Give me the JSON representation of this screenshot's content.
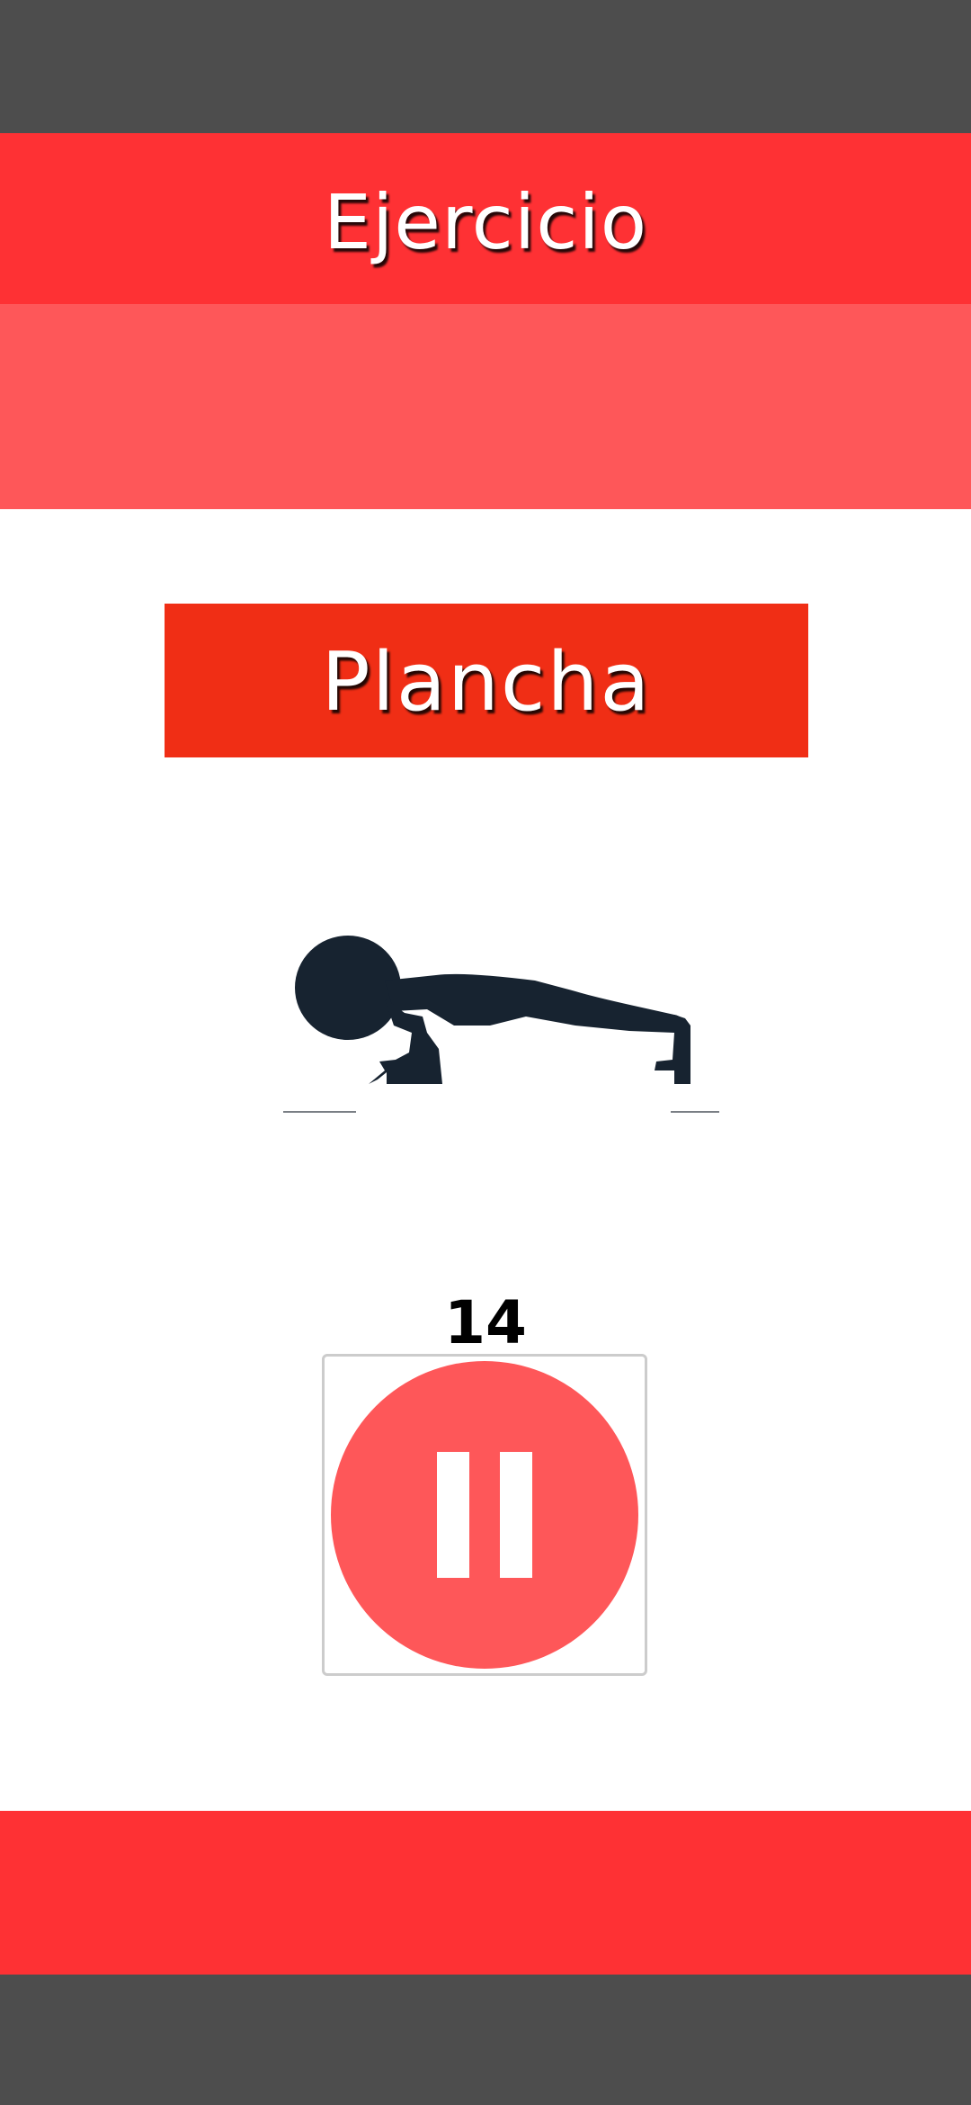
{
  "header": {
    "title": "Ejercicio"
  },
  "exercise": {
    "name": "Plancha",
    "illustration": "push-up-figure"
  },
  "timer": {
    "count": "14"
  },
  "controls": {
    "pause_icon": "pause-icon"
  },
  "colors": {
    "primary_red": "#fe3134",
    "light_red": "#fe5759",
    "banner_red": "#f02e15",
    "system_bar": "#4d4d4d",
    "figure": "#172330"
  }
}
